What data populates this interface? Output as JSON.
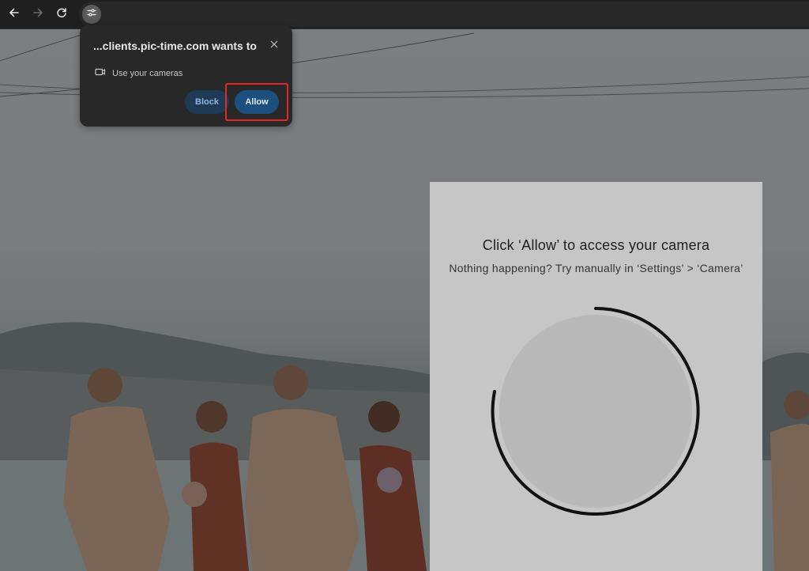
{
  "browser": {
    "back_icon": "arrow-left-icon",
    "forward_icon": "arrow-right-icon",
    "reload_icon": "reload-icon",
    "site_info_icon": "tune-icon"
  },
  "permission_popup": {
    "title": "...clients.pic-time.com wants to",
    "permission_label": "Use your cameras",
    "permission_icon": "video-camera-icon",
    "block_label": "Block",
    "allow_label": "Allow",
    "close_icon": "close-icon"
  },
  "camera_panel": {
    "title": "Click ‘Allow’ to access your camera",
    "subtitle": "Nothing happening? Try manually in ‘Settings’ > ‘Camera’"
  },
  "colors": {
    "highlight": "#e3282a",
    "allow_button": "#1d4f7e",
    "block_button": "#1f3a55",
    "panel_bg": "#c6c6c6"
  }
}
